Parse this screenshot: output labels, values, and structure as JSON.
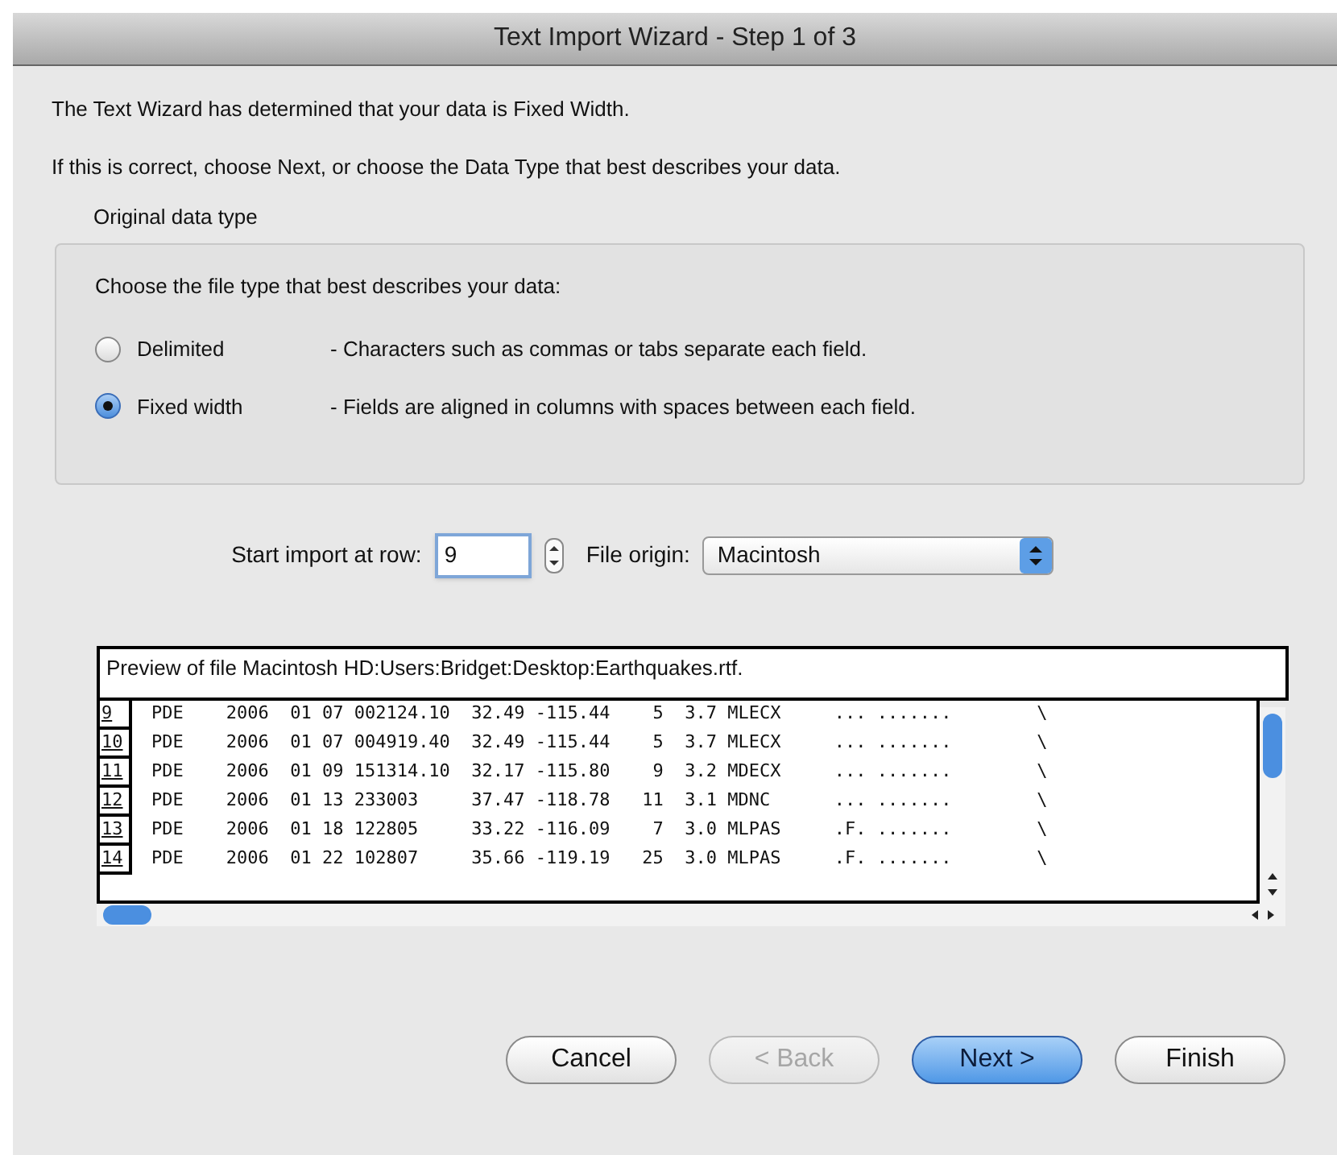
{
  "window": {
    "title": "Text Import Wizard - Step 1 of 3"
  },
  "intro": [
    "The Text Wizard has determined that your data is Fixed Width.",
    "If this is correct, choose Next, or choose the Data Type that best describes your data."
  ],
  "group": {
    "label": "Original data type",
    "prompt": "Choose the file type that best describes your data:",
    "options": [
      {
        "label": "Delimited",
        "description": "- Characters such as commas or tabs separate each field.",
        "selected": false
      },
      {
        "label": "Fixed width",
        "description": "- Fields are aligned in columns with spaces between each field.",
        "selected": true
      }
    ]
  },
  "start_row": {
    "label": "Start import at row:",
    "value": "9"
  },
  "file_origin": {
    "label": "File origin:",
    "value": "Macintosh"
  },
  "preview": {
    "title": "Preview of file Macintosh HD:Users:Bridget:Desktop:Earthquakes.rtf.",
    "rows": [
      {
        "number": "9",
        "text": "PDE    2006  01 07 002124.10  32.49 -115.44    5  3.7 MLECX     ... .......        \\"
      },
      {
        "number": "10",
        "text": "PDE    2006  01 07 004919.40  32.49 -115.44    5  3.7 MLECX     ... .......        \\"
      },
      {
        "number": "11",
        "text": "PDE    2006  01 09 151314.10  32.17 -115.80    9  3.2 MDECX     ... .......        \\"
      },
      {
        "number": "12",
        "text": "PDE    2006  01 13 233003     37.47 -118.78   11  3.1 MDNC      ... .......        \\"
      },
      {
        "number": "13",
        "text": "PDE    2006  01 18 122805     33.22 -116.09    7  3.0 MLPAS     .F. .......        \\"
      },
      {
        "number": "14",
        "text": "PDE    2006  01 22 102807     35.66 -119.19   25  3.0 MLPAS     .F. .......        \\"
      }
    ]
  },
  "buttons": [
    {
      "label": "Cancel",
      "kind": "normal",
      "disabled": false
    },
    {
      "label": "< Back",
      "kind": "normal",
      "disabled": true
    },
    {
      "label": "Next >",
      "kind": "default",
      "disabled": false
    },
    {
      "label": "Finish",
      "kind": "normal",
      "disabled": false
    }
  ]
}
